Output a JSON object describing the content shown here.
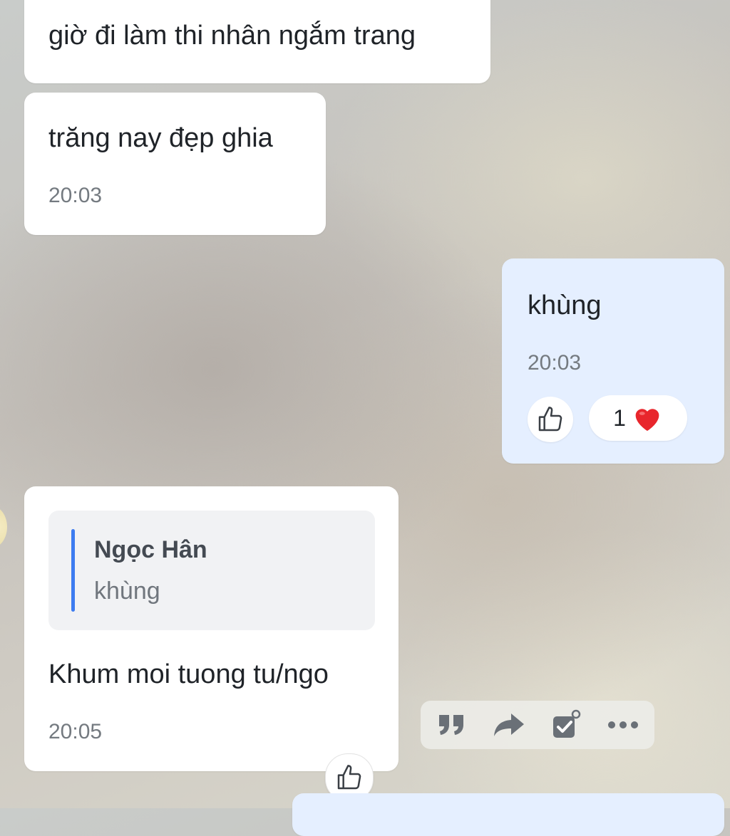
{
  "messages": [
    {
      "text": "giờ đi làm thi nhân ngắm trang"
    },
    {
      "text": "trăng nay đẹp ghia",
      "time": "20:03"
    },
    {
      "text": "khùng",
      "time": "20:03",
      "reaction_count": "1"
    },
    {
      "quote_name": "Ngọc Hân",
      "quote_text": "khùng",
      "text": "Khum moi tuong tu/ngo",
      "time": "20:05"
    }
  ],
  "icons": {
    "like": "thumbs-up-icon",
    "heart": "heart-icon",
    "quote": "quote-icon",
    "forward": "forward-icon",
    "task": "task-icon",
    "more": "more-icon"
  },
  "colors": {
    "incoming_bubble": "#ffffff",
    "outgoing_bubble": "#e5efff",
    "quote_bar": "#3d7cf0",
    "heart": "#e8262c"
  }
}
